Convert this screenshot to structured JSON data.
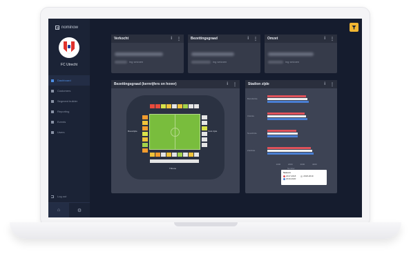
{
  "brand": {
    "name": "nominow"
  },
  "club": {
    "name": "FC Utrecht"
  },
  "nav": {
    "items": [
      {
        "label": "Dashboard",
        "active": true
      },
      {
        "label": "Customers",
        "active": false
      },
      {
        "label": "Segment builder",
        "active": false
      },
      {
        "label": "Reporting",
        "active": false
      },
      {
        "label": "Events",
        "active": false
      },
      {
        "label": "Users",
        "active": false
      }
    ],
    "logout": "Log out"
  },
  "kpi_cards": [
    {
      "title": "Verkocht",
      "sub_text": "ing seizoen"
    },
    {
      "title": "Bezettingsgraad",
      "sub_text": "ing seizoen"
    },
    {
      "title": "Omzet",
      "sub_text": "ing seizoen"
    }
  ],
  "stadium_panel": {
    "title": "Bezettingsgraad (kernrijfers on hover)",
    "labels": {
      "west": "Bouwzijde",
      "east": "Oost zijde",
      "south": "Tribune"
    }
  },
  "chart_panel": {
    "title": "Stadion zijde",
    "legend_title": "Season",
    "chart_data": {
      "type": "bar",
      "orientation": "horizontal",
      "categories": [
        "Bunnikzide",
        "Clazule",
        "Noordzide",
        "Zuidzide"
      ],
      "xlabel": "Number",
      "xlim": [
        0,
        4000
      ],
      "xticks": [
        "1000",
        "2000",
        "3000",
        "4000"
      ],
      "series": [
        {
          "name": "2017-2018",
          "color": "#e0525a",
          "values": [
            3200,
            3100,
            2400,
            3600
          ]
        },
        {
          "name": "2018-2019",
          "color": "#f1f1f1",
          "values": [
            3300,
            3200,
            2500,
            3700
          ]
        },
        {
          "name": "2019-2020",
          "color": "#4a7fd4",
          "values": [
            3400,
            3300,
            2500,
            3800
          ]
        }
      ]
    }
  },
  "colors": {
    "accent": "#f2b632",
    "active_nav": "#4d8fe6",
    "screen_bg": "#151c2e"
  }
}
